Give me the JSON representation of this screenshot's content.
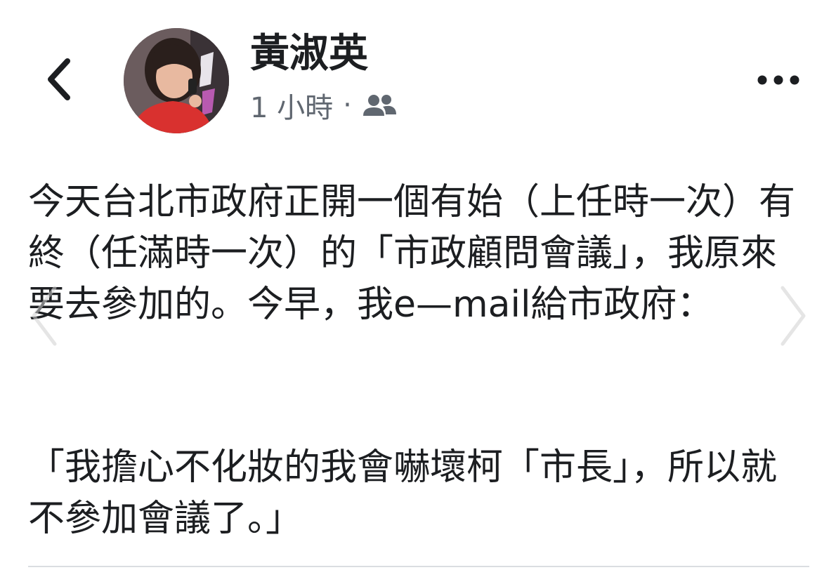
{
  "header": {
    "author_name": "黃淑英",
    "timestamp": "1 小時",
    "separator": "·",
    "audience_icon": "friends-icon",
    "back_icon": "chevron-left-icon",
    "more_icon": "more-dots-icon"
  },
  "post": {
    "paragraph": "今天台北市政府正開一個有始（上任時一次）有終（任滿時一次）的「市政顧問會議」，我原來要去參加的。今早，我e—mail給市政府：",
    "quote": "「我擔心不化妝的我會嚇壞柯「市長」，所以就不參加會議了。」"
  },
  "carousel": {
    "prev_icon": "chevron-left-icon",
    "next_icon": "chevron-right-icon"
  },
  "colors": {
    "text": "#1c1e21",
    "meta": "#606770",
    "divider": "#dadde1"
  }
}
